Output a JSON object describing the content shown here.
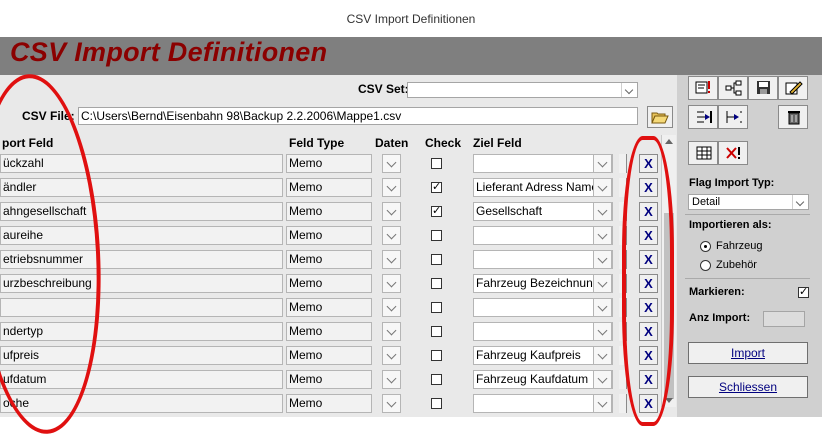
{
  "window": {
    "title": "CSV Import Definitionen"
  },
  "header": {
    "title": "CSV Import Definitionen"
  },
  "csv_set": {
    "label": "CSV Set:",
    "value": ""
  },
  "csv_file": {
    "label": "CSV File:",
    "value": "C:\\Users\\Bernd\\Eisenbahn 98\\Backup 2.2.2006\\Mappe1.csv"
  },
  "columns": {
    "import_feld": "port Feld",
    "feld_type": "Feld Type",
    "daten": "Daten",
    "check": "Check",
    "ziel_feld": "Ziel Feld"
  },
  "rows": [
    {
      "import": "ückzahl",
      "type": "Memo",
      "check": false,
      "ziel": ""
    },
    {
      "import": "ändler",
      "type": "Memo",
      "check": true,
      "ziel": "Lieferant Adress Name"
    },
    {
      "import": "ahngesellschaft",
      "type": "Memo",
      "check": true,
      "ziel": "Gesellschaft"
    },
    {
      "import": "aureihe",
      "type": "Memo",
      "check": false,
      "ziel": ""
    },
    {
      "import": "etriebsnummer",
      "type": "Memo",
      "check": false,
      "ziel": ""
    },
    {
      "import": "urzbeschreibung",
      "type": "Memo",
      "check": false,
      "ziel": "Fahrzeug Bezeichnung"
    },
    {
      "import": "",
      "type": "Memo",
      "check": false,
      "ziel": ""
    },
    {
      "import": "ndertyp",
      "type": "Memo",
      "check": false,
      "ziel": ""
    },
    {
      "import": "ufpreis",
      "type": "Memo",
      "check": false,
      "ziel": "Fahrzeug Kaufpreis"
    },
    {
      "import": "ufdatum",
      "type": "Memo",
      "check": false,
      "ziel": "Fahrzeug Kaufdatum"
    },
    {
      "import": "oche",
      "type": "Memo",
      "check": false,
      "ziel": ""
    }
  ],
  "delete_glyph": "X",
  "side": {
    "flag_import_label": "Flag Import  Typ:",
    "flag_import_value": "Detail",
    "importieren_label": "Importieren als:",
    "radio_fahrzeug": "Fahrzeug",
    "radio_zubehoer": "Zubehör",
    "markieren_label": "Markieren:",
    "markieren_checked": true,
    "anz_import_label": "Anz Import:",
    "anz_import_value": "",
    "import_button": "Import",
    "schliessen_button": "Schliessen"
  },
  "colors": {
    "header_bg": "#7f7f7f",
    "header_text": "#8b0000",
    "annotation": "#e01010",
    "x_color": "#00007f"
  }
}
